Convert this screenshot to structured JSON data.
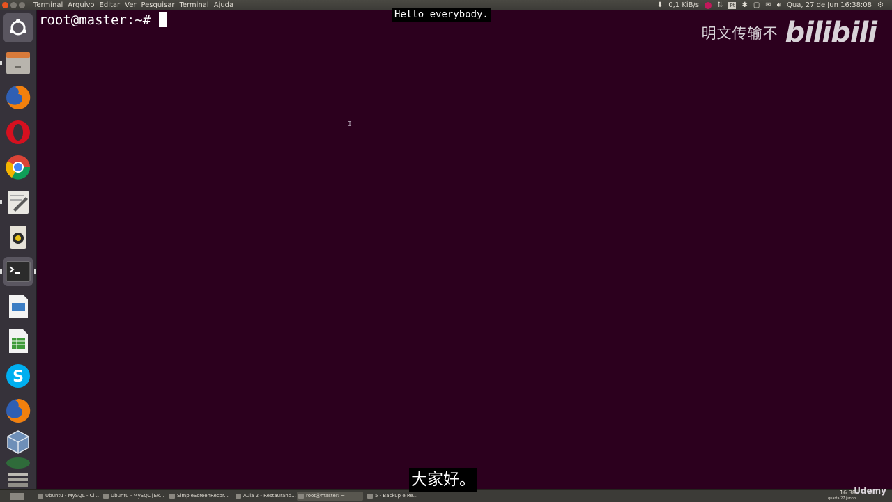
{
  "topbar": {
    "menus": [
      "Terminal",
      "Arquivo",
      "Editar",
      "Ver",
      "Pesquisar",
      "Terminal",
      "Ajuda"
    ],
    "net_speed": "0,1 KiB/s",
    "datetime": "Qua, 27 de Jun 16:38:08",
    "pt_label": "Pt"
  },
  "terminal": {
    "prompt": "root@master:~#"
  },
  "subtitles": {
    "english": "Hello everybody.",
    "chinese": "大家好。"
  },
  "watermark": {
    "text": "明文传输不",
    "logo": "bilibili"
  },
  "taskbar": {
    "tasks": [
      {
        "label": "Ubuntu - MySQL - Cl..."
      },
      {
        "label": "Ubuntu - MySQL [Ex..."
      },
      {
        "label": "SimpleScreenRecor..."
      },
      {
        "label": "Aula 2 - Restaurand..."
      },
      {
        "label": "root@master: ~"
      },
      {
        "label": "5 - Backup e Re..."
      }
    ],
    "clock_time": "16:38",
    "clock_date": "quarta 27 junho",
    "udemy": "Udemy"
  },
  "colors": {
    "terminal_bg": "#2c001e",
    "panel_bg": "#3c3b37",
    "close_button": "#e9541f"
  }
}
